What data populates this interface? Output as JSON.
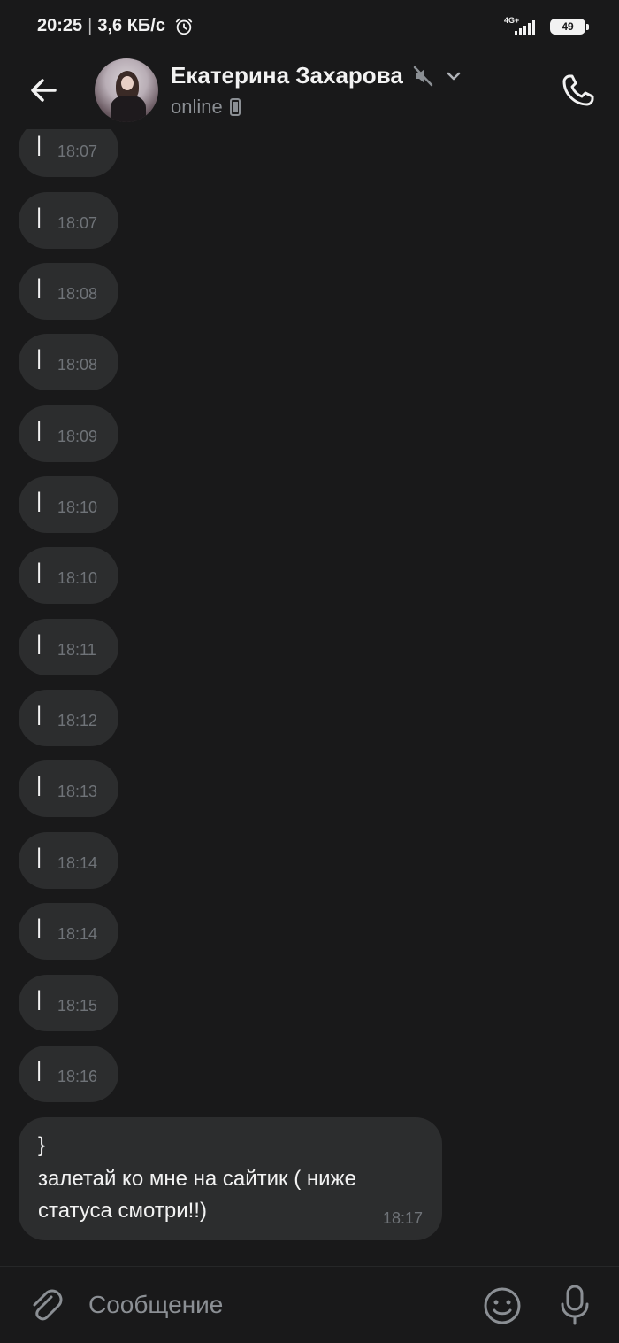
{
  "status_bar": {
    "time": "20:25",
    "separator": "|",
    "speed": "3,6 КБ/с",
    "network": "4G+",
    "battery": "49"
  },
  "header": {
    "contact_name": "Екатерина Захарова",
    "status": "online"
  },
  "messages": [
    {
      "text": "|",
      "time": "18:07"
    },
    {
      "text": "|",
      "time": "18:07"
    },
    {
      "text": "|",
      "time": "18:08"
    },
    {
      "text": "|",
      "time": "18:08"
    },
    {
      "text": "|",
      "time": "18:09"
    },
    {
      "text": "|",
      "time": "18:10"
    },
    {
      "text": "|",
      "time": "18:10"
    },
    {
      "text": "|",
      "time": "18:11"
    },
    {
      "text": "|",
      "time": "18:12"
    },
    {
      "text": "|",
      "time": "18:13"
    },
    {
      "text": "|",
      "time": "18:14"
    },
    {
      "text": "|",
      "time": "18:14"
    },
    {
      "text": "|",
      "time": "18:15"
    },
    {
      "text": "|",
      "time": "18:16"
    }
  ],
  "last_message": {
    "lines": [
      "}",
      "залетай ко мне на сайтик ( ниже",
      "статуса смотри!!)"
    ],
    "time": "18:17"
  },
  "composer": {
    "placeholder": "Сообщение"
  },
  "icons": {
    "back": "arrow-left-icon",
    "mute": "muted-speaker-icon",
    "dropdown": "chevron-down-icon",
    "device": "mobile-phone-icon",
    "call": "phone-icon",
    "attach": "paperclip-icon",
    "emoji": "smile-icon",
    "mic": "microphone-icon",
    "alarm": "alarm-clock-icon"
  },
  "colors": {
    "background": "#19191a",
    "bubble": "#2c2d2e",
    "text": "#f2f2f2",
    "muted_text": "#8b8f94",
    "time_text": "#6f7378"
  }
}
